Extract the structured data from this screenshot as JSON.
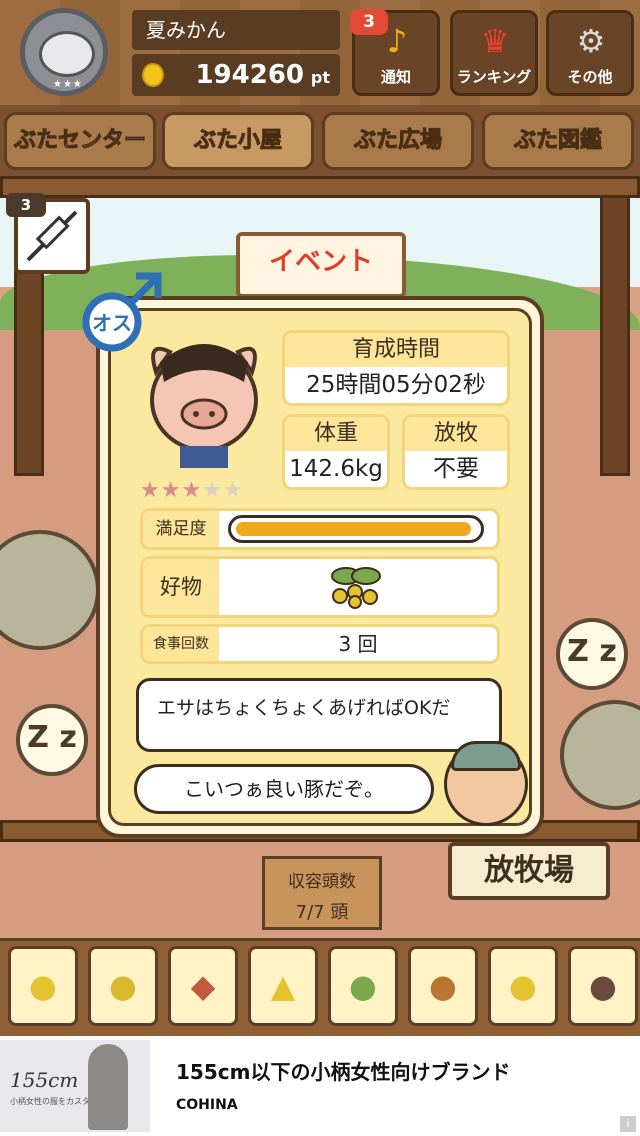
{
  "header": {
    "player_name": "夏みかん",
    "points": "194260",
    "points_unit": "pt",
    "notification_count": "3",
    "buttons": [
      {
        "label": "通知",
        "icon": "bell-icon"
      },
      {
        "label": "ランキング",
        "icon": "crown-icon"
      },
      {
        "label": "その他",
        "icon": "gear-icon"
      }
    ]
  },
  "nav": {
    "tabs": [
      "ぶたセンター",
      "ぶた小屋",
      "ぶた広場",
      "ぶた図鑑"
    ],
    "active_tab": "ぶた小屋"
  },
  "scene": {
    "event_sign": "イベント",
    "syringe_count": "3",
    "capacity_label": "収容頭数",
    "capacity_value": "7/7 頭",
    "pasture_label": "放牧場",
    "sleep_text": "Z z"
  },
  "pig_card": {
    "gender_label": "オス",
    "rating": 3,
    "rating_max": 5,
    "rating_stars": "★★★",
    "rating_empty": "★★",
    "growth_time_label": "育成時間",
    "growth_time_value": "25時間05分02秒",
    "weight_label": "体重",
    "weight_value": "142.6kg",
    "grazing_label": "放牧",
    "grazing_value": "不要",
    "satisfaction_label": "満足度",
    "satisfaction_fraction": 0.98,
    "favorite_label": "好物",
    "favorite_icon": "nut-bunch-icon",
    "meals_label": "食事回数",
    "meals_value": "3 回",
    "farmer_tip": "エサはちょくちょくあげればOKだ",
    "farmer_comment": "こいつぁ良い豚だぞ。"
  },
  "food_items": [
    {
      "name": "soybean-pile-icon",
      "glyph": "●"
    },
    {
      "name": "grain-pile-icon",
      "glyph": "●"
    },
    {
      "name": "sweet-potato-icon",
      "glyph": "◆"
    },
    {
      "name": "corn-icon",
      "glyph": "▲"
    },
    {
      "name": "nut-bunch-icon",
      "glyph": "●"
    },
    {
      "name": "acorn-icon",
      "glyph": "●"
    },
    {
      "name": "bean-dish-icon",
      "glyph": "●"
    },
    {
      "name": "chocolate-dish-icon",
      "glyph": "●"
    }
  ],
  "ad": {
    "title": "155cm以下の小柄女性向けブランド",
    "brand": "COHINA",
    "image_text": "155cm",
    "image_subtext": "小柄女性の服をカスタマイズ",
    "info": "i"
  },
  "colors": {
    "accent_yellow": "#fde59a",
    "satisfaction_bar": "#f0a81c",
    "badge_red": "#e24a35",
    "male_blue": "#2e6fb8"
  }
}
